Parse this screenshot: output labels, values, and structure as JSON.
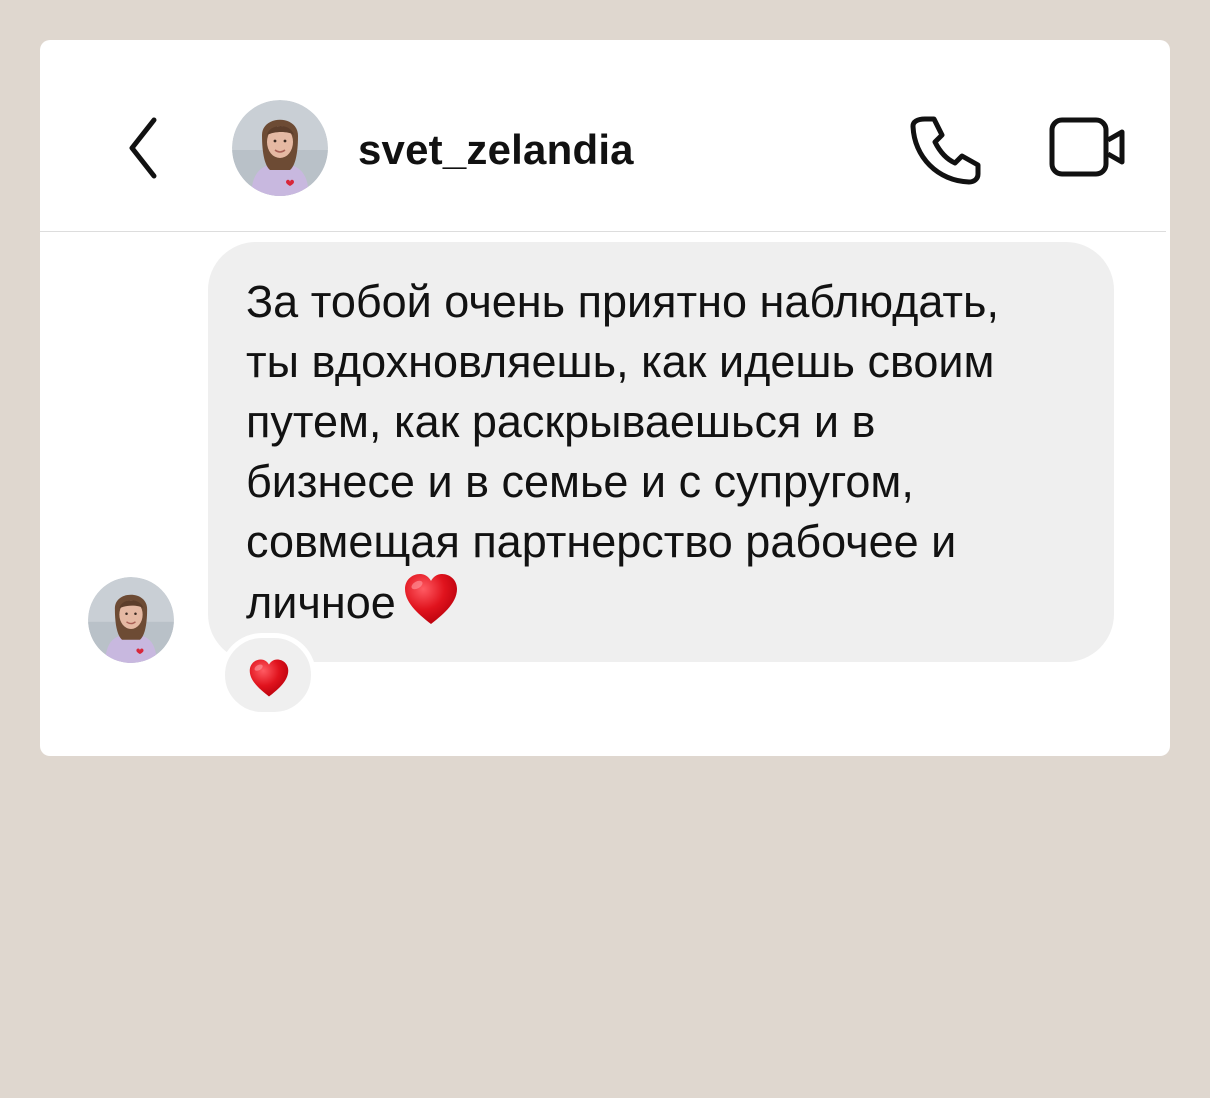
{
  "header": {
    "username": "svet_zelandia",
    "back_icon": "chevron-left-icon",
    "avatar": "profile-photo-avatar",
    "call_icon": "phone-icon",
    "video_icon": "video-camera-icon"
  },
  "message": {
    "text": "За тобой очень приятно наблюдать,\nты вдохновляешь, как идешь своим\nпутем, как раскрываешься и в\nбизнесе и в семье и с супругом,\nсовмещая партнерство рабочее и\nличное",
    "inline_emoji": "red-heart-icon",
    "sender_avatar": "profile-photo-avatar"
  },
  "reaction": {
    "emoji": "red-heart-icon"
  },
  "colors": {
    "background": "#dfd7cf",
    "card": "#ffffff",
    "bubble": "#efefef",
    "heart": "#e0131d"
  }
}
